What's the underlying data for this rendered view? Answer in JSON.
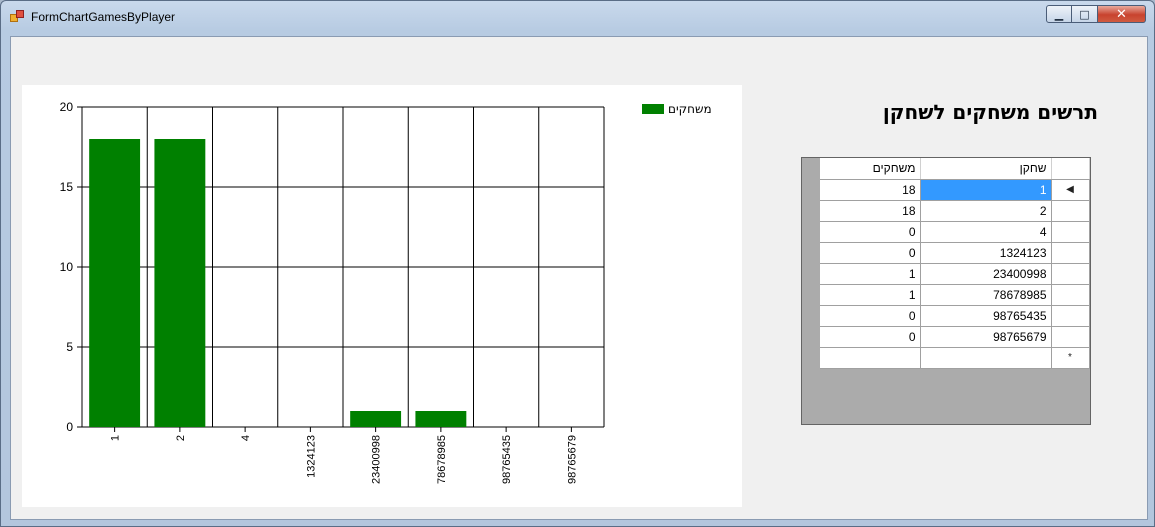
{
  "window": {
    "title": "FormChartGamesByPlayer",
    "controls": {
      "minimize": "▁",
      "maximize": "□",
      "close": "✕"
    }
  },
  "form": {
    "heading": "תרשים משחקים לשחקן"
  },
  "grid": {
    "columns": {
      "player": "שחקן",
      "games": "משחקים"
    },
    "rows": [
      {
        "player": "1",
        "games": "18",
        "selected": true,
        "indicator": "◀"
      },
      {
        "player": "2",
        "games": "18"
      },
      {
        "player": "4",
        "games": "0"
      },
      {
        "player": "1324123",
        "games": "0"
      },
      {
        "player": "23400998",
        "games": "1"
      },
      {
        "player": "78678985",
        "games": "1"
      },
      {
        "player": "98765435",
        "games": "0"
      },
      {
        "player": "98765679",
        "games": "0"
      }
    ],
    "new_row_indicator": "*"
  },
  "chart_data": {
    "type": "bar",
    "categories": [
      "1",
      "2",
      "4",
      "1324123",
      "23400998",
      "78678985",
      "98765435",
      "98765679"
    ],
    "series": [
      {
        "name": "משחקים",
        "values": [
          18,
          18,
          0,
          0,
          1,
          1,
          0,
          0
        ],
        "color": "#008000"
      }
    ],
    "ylim": [
      0,
      20
    ],
    "yticks": [
      0,
      5,
      10,
      15,
      20
    ],
    "xlabel": "",
    "ylabel": "",
    "grid": true,
    "legend_position": "top-right"
  }
}
